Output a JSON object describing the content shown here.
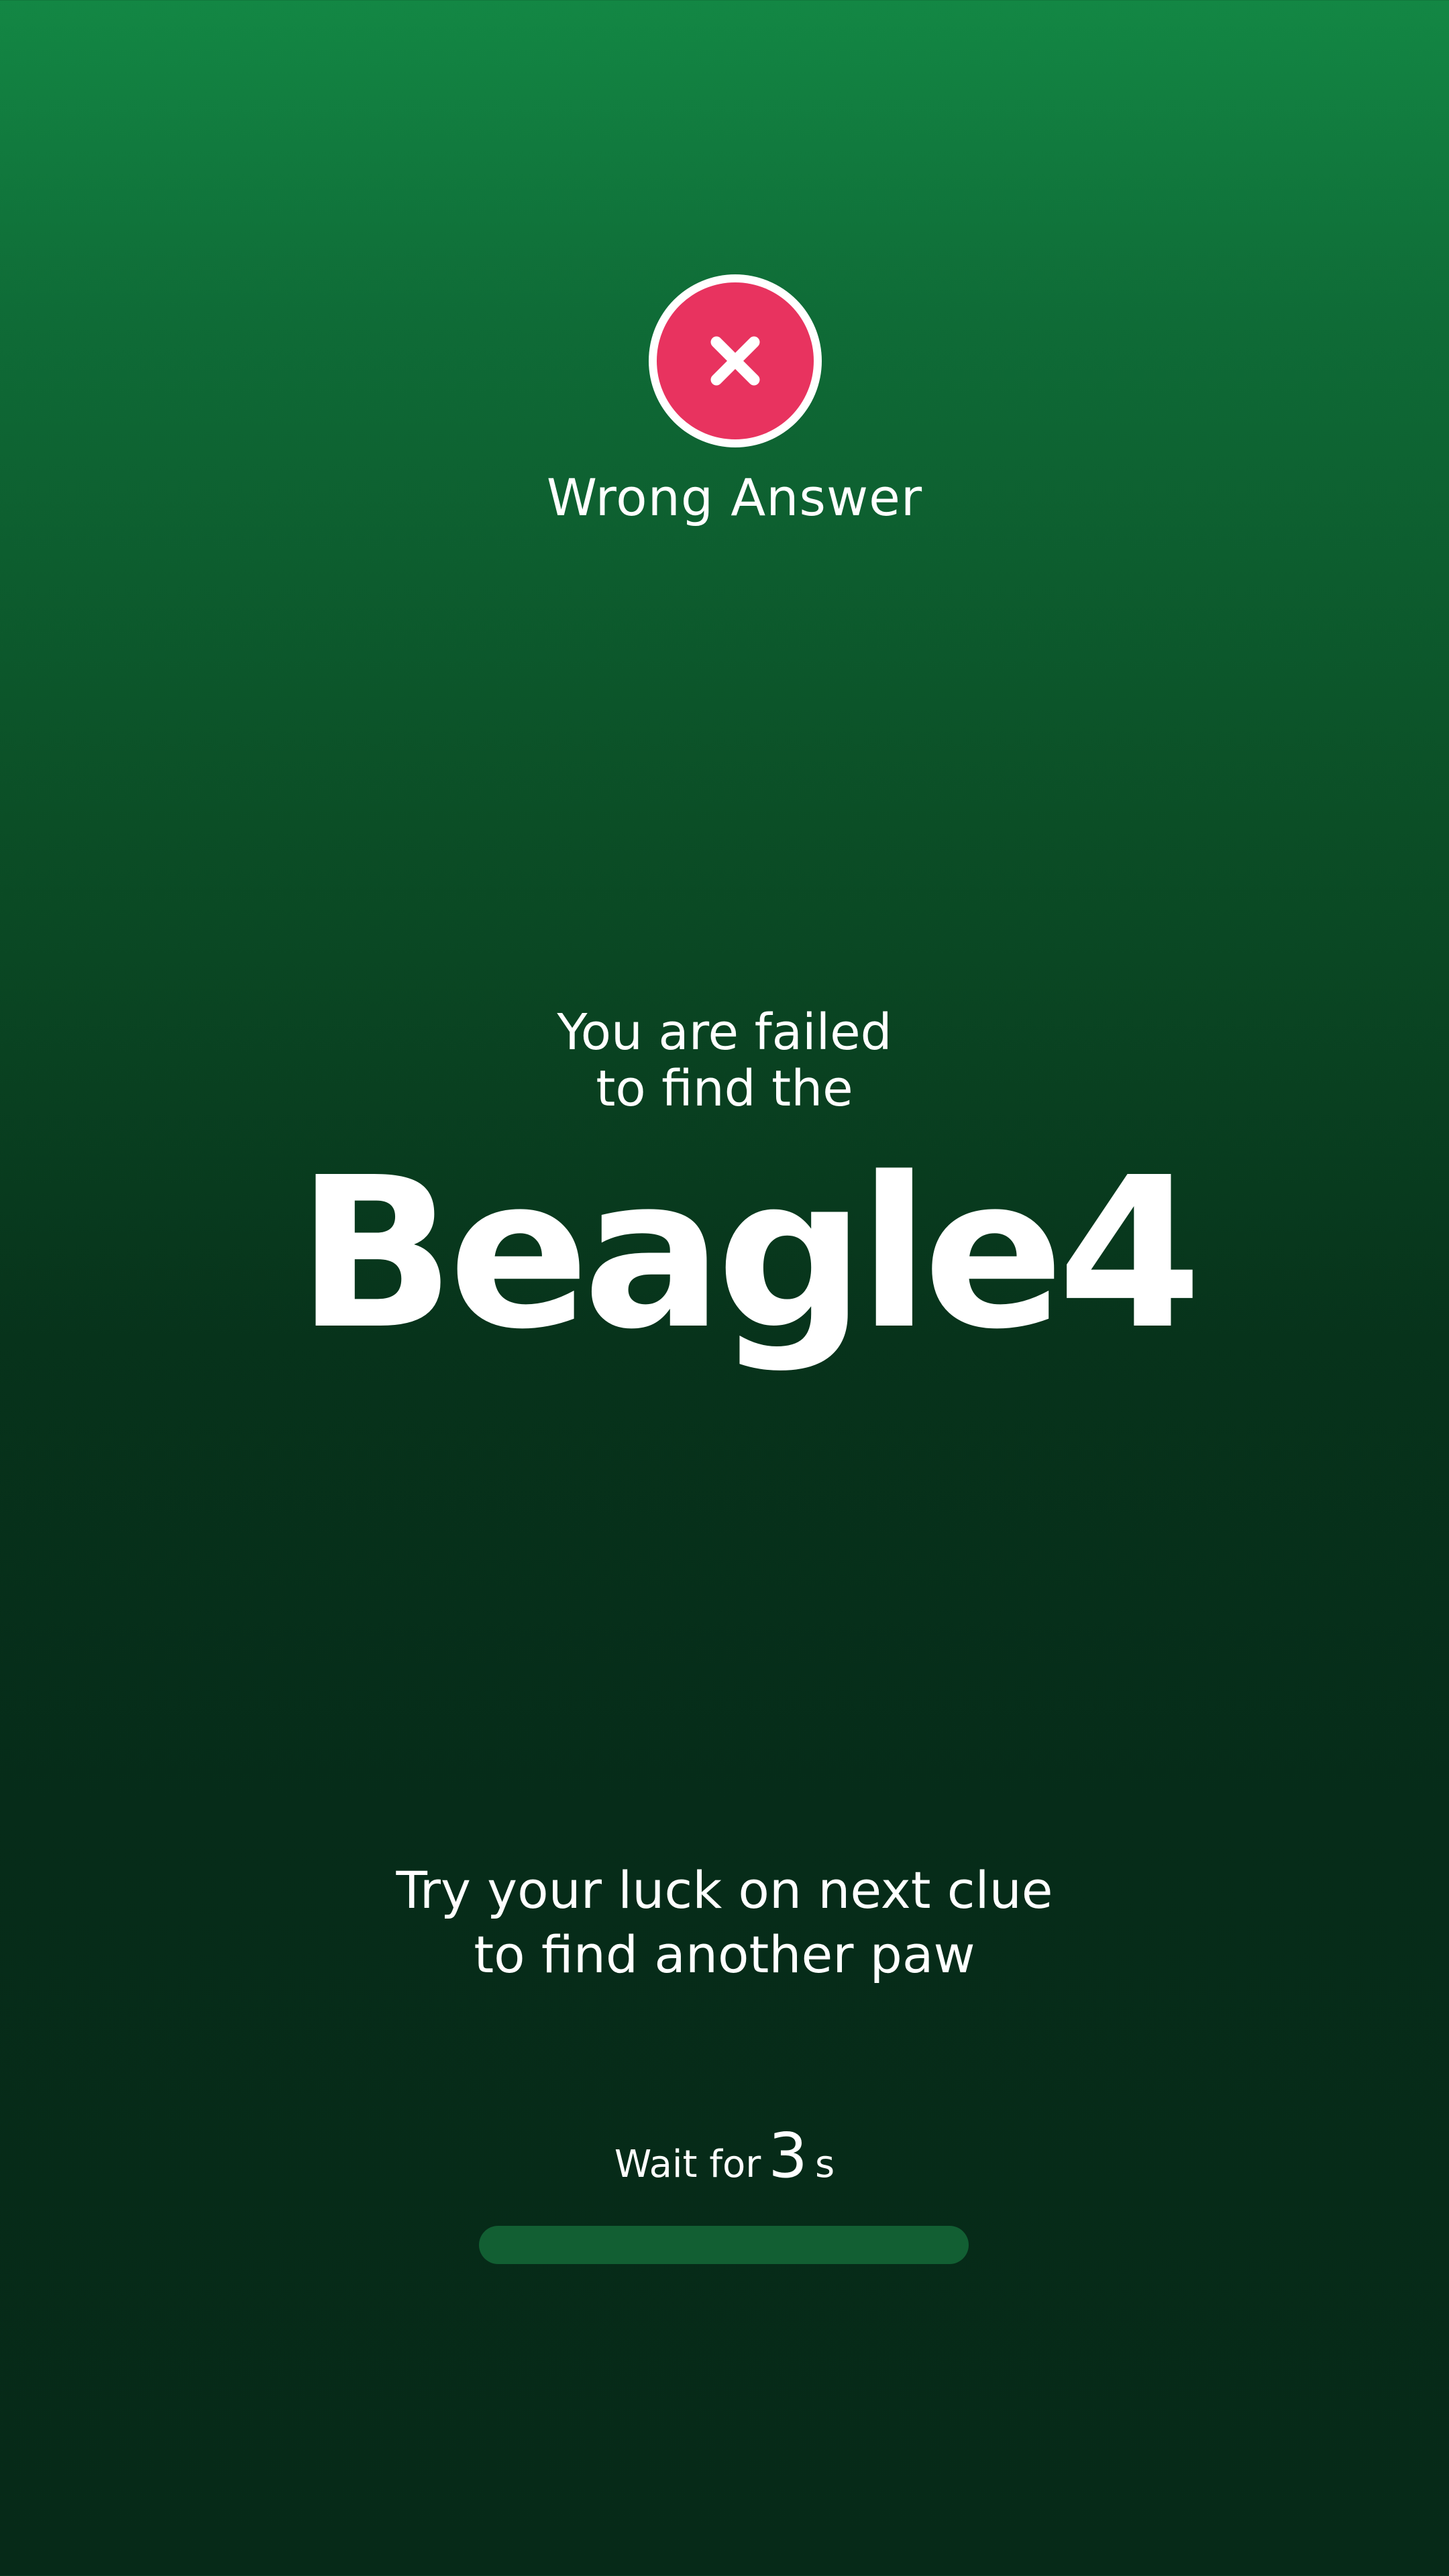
{
  "status": {
    "icon": "close-icon",
    "label": "Wrong Answer",
    "color": "#e8335f"
  },
  "result": {
    "intro_line1": "You are failed",
    "intro_line2": "to find the",
    "answer": "Beagle4"
  },
  "message": {
    "line1": "Try your luck on next clue",
    "line2": "to find another paw"
  },
  "timer": {
    "prefix": "Wait for",
    "seconds": "3",
    "unit": "s",
    "progress": 0
  }
}
